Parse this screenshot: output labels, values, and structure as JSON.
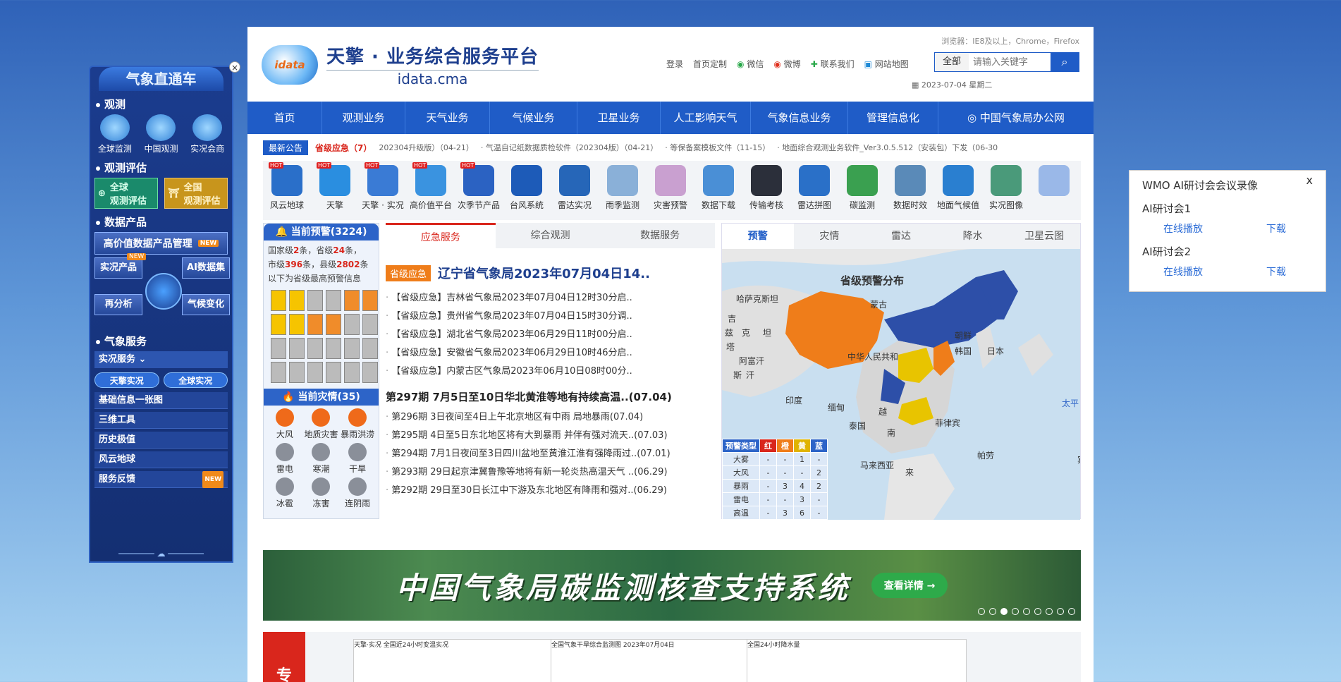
{
  "left_panel": {
    "title": "气象直通车",
    "sections": {
      "observe": "观测",
      "eval": "观测评估",
      "data": "数据产品",
      "service": "气象服务"
    },
    "observe_items": [
      "全球监测",
      "中国观测",
      "实况会商"
    ],
    "eval_items": [
      "全球\n观测评估",
      "全国\n观测评估"
    ],
    "high_value": "高价值数据产品管理",
    "new_badge": "NEW",
    "products": [
      "实况产品",
      "AI数据集",
      "再分析",
      "气候变化"
    ],
    "realtime_service": "实况服务",
    "realtime_pills": [
      "天擎实况",
      "全球实况"
    ],
    "list": [
      "基础信息一张图",
      "三维工具",
      "历史极值",
      "风云地球",
      "服务反馈"
    ]
  },
  "header": {
    "logo_text": "idata",
    "title": "天擎 · 业务综合服务平台",
    "subtitle": "idata.cma",
    "browser_note": "浏览器：IE8及以上，Chrome，Firefox",
    "top_links": [
      "登录",
      "首页定制",
      "微信",
      "微博",
      "联系我们",
      "网站地图"
    ],
    "search_scope": "全部",
    "search_placeholder": "请输入关键字",
    "date": "2023-07-04 星期二"
  },
  "nav": [
    "首页",
    "观测业务",
    "天气业务",
    "气候业务",
    "卫星业务",
    "人工影响天气",
    "气象信息业务",
    "管理信息化",
    "中国气象局办公网"
  ],
  "notice": {
    "label": "最新公告",
    "urgent": "省级应急（7）",
    "items": [
      "202304升级版）（04-21）",
      "· 气温自记纸数据质检软件（202304版）（04-21）",
      "· 等保备案模板文件（11-15）",
      "· 地面综合观测业务软件_Ver3.0.5.512（安装包）下发（06-30"
    ]
  },
  "icons": [
    {
      "label": "风云地球",
      "hot": true,
      "color": "#2a6fc9"
    },
    {
      "label": "天擎",
      "hot": true,
      "color": "#2a8ee0"
    },
    {
      "label": "天擎 · 实况",
      "hot": true,
      "color": "#3a7bd5"
    },
    {
      "label": "高价值平台",
      "hot": true,
      "color": "#3a93e0"
    },
    {
      "label": "次季节产品",
      "hot": true,
      "color": "#2b62c2"
    },
    {
      "label": "台风系统",
      "hot": false,
      "color": "#1d5bb8"
    },
    {
      "label": "雷达实况",
      "hot": false,
      "color": "#2666b8"
    },
    {
      "label": "雨季监测",
      "hot": false,
      "color": "#8ab0d8"
    },
    {
      "label": "灾害预警",
      "hot": false,
      "color": "#c9a0d0"
    },
    {
      "label": "数据下载",
      "hot": false,
      "color": "#4a8fd6"
    },
    {
      "label": "传输考核",
      "hot": false,
      "color": "#2b2f3a"
    },
    {
      "label": "雷达拼图",
      "hot": false,
      "color": "#2a70c8"
    },
    {
      "label": "碳监测",
      "hot": false,
      "color": "#3aa050"
    },
    {
      "label": "数据时效",
      "hot": false,
      "color": "#5a8ab8"
    },
    {
      "label": "地面气候值",
      "hot": false,
      "color": "#2a7fd0"
    },
    {
      "label": "实况图像",
      "hot": false,
      "color": "#4a9a7a"
    },
    {
      "label": "",
      "hot": false,
      "color": "#9ab8e8"
    }
  ],
  "warning": {
    "current": "当前预警(3224)",
    "summary_1": "国家级",
    "n1": "2",
    "summary_2": "条，省级",
    "n2": "24",
    "summary_3": "条，",
    "summary_4": "市级",
    "n3": "396",
    "summary_5": "条，县级",
    "n4": "2802",
    "summary_6": "条",
    "summary_7": "以下为省级最高预警信息",
    "disaster": "当前灾情(35)",
    "disaster_items": [
      "大风",
      "地质灾害",
      "暴雨洪涝",
      "雷电",
      "寒潮",
      "干旱",
      "冰雹",
      "冻害",
      "连阴雨"
    ]
  },
  "middle": {
    "tabs": [
      "应急服务",
      "综合观测",
      "数据服务"
    ],
    "tag": "省级应急",
    "headline": "辽宁省气象局2023年07月04日14..",
    "news": [
      "【省级应急】吉林省气象局2023年07月04日12时30分启..",
      "【省级应急】贵州省气象局2023年07月04日15时30分调..",
      "【省级应急】湖北省气象局2023年06月29日11时00分启..",
      "【省级应急】安徽省气象局2023年06月29日10时46分启..",
      "【省级应急】内蒙古区气象局2023年06月10日08时00分.."
    ],
    "section2": "第297期 7月5日至10日华北黄淮等地有持续高温..(07.04)",
    "news2": [
      "第296期 3日夜间至4日上午北京地区有中雨 局地暴雨(07.04)",
      "第295期 4日至5日东北地区将有大到暴雨 并伴有强对流天..(07.03)",
      "第294期 7月1日夜间至3日四川盆地至黄淮江淮有强降雨过..(07.01)",
      "第293期 29日起京津冀鲁豫等地将有新一轮炎热高温天气 ..(06.29)",
      "第292期 29日至30日长江中下游及东北地区有降雨和强对..(06.29)"
    ]
  },
  "map": {
    "tabs": [
      "预警",
      "灾情",
      "雷达",
      "降水",
      "卫星云图"
    ],
    "title": "省级预警分布",
    "places": [
      "哈萨克斯坦",
      "蒙古",
      "朝鲜",
      "韩国",
      "日本",
      "阿富汗",
      "中华人民共和",
      "印度",
      "缅甸",
      "泰国",
      "越",
      "南",
      "菲律宾",
      "帕劳",
      "马来西亚",
      "来",
      "太平",
      "吉",
      "兹",
      "塔",
      "克",
      "坦",
      "斯",
      "汗",
      "宾"
    ],
    "legend_header": [
      "预警类型",
      "红",
      "橙",
      "黄",
      "蓝"
    ],
    "legend_colors": [
      "#2d64c8",
      "#d9261c",
      "#ef7d1a",
      "#e0b400",
      "#2d64c8"
    ],
    "legend_rows": [
      [
        "大雾",
        "-",
        "-",
        "1",
        "-"
      ],
      [
        "大风",
        "-",
        "-",
        "-",
        "2"
      ],
      [
        "暴雨",
        "-",
        "3",
        "4",
        "2"
      ],
      [
        "雷电",
        "-",
        "-",
        "3",
        "-"
      ],
      [
        "高温",
        "-",
        "3",
        "6",
        "-"
      ]
    ]
  },
  "banner": {
    "title": "中国气象局碳监测核查支持系统",
    "button": "查看详情 →"
  },
  "thumbs": {
    "tag": "专",
    "items": [
      "天擎·实况  全国近24小时变温实况",
      "全国气象干旱综合监测图 2023年07月04日",
      "全国24小时降水量"
    ]
  },
  "popup": {
    "title": "WMO AI研讨会会议录像",
    "close": "x",
    "sessions": [
      {
        "name": "AI研讨会1",
        "play": "在线播放",
        "download": "下载"
      },
      {
        "name": "AI研讨会2",
        "play": "在线播放",
        "download": "下载"
      }
    ]
  }
}
